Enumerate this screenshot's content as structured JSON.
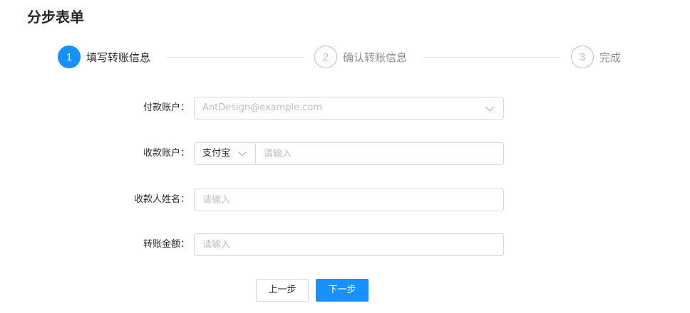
{
  "page": {
    "title": "分步表单"
  },
  "steps": [
    {
      "number": "1",
      "title": "填写转账信息",
      "status": "active"
    },
    {
      "number": "2",
      "title": "确认转账信息",
      "status": "wait"
    },
    {
      "number": "3",
      "title": "完成",
      "status": "wait"
    }
  ],
  "form": {
    "pay_account": {
      "label": "付款账户：",
      "value": "",
      "placeholder": "AntDesign@example.com",
      "icon": "chevron-down-icon"
    },
    "receiver_account": {
      "label": "收款账户：",
      "type_value": "支付宝",
      "value": "",
      "placeholder": "请输入",
      "icon": "chevron-down-icon"
    },
    "receiver_name": {
      "label": "收款人姓名：",
      "value": "",
      "placeholder": "请输入"
    },
    "amount": {
      "label": "转账金额：",
      "value": "",
      "placeholder": "请输入"
    }
  },
  "actions": {
    "prev_label": "上一步",
    "next_label": "下一步"
  },
  "colors": {
    "primary": "#1890ff",
    "border": "#d9d9d9",
    "placeholder": "#bfbfbf",
    "line": "#e8e8e8"
  }
}
